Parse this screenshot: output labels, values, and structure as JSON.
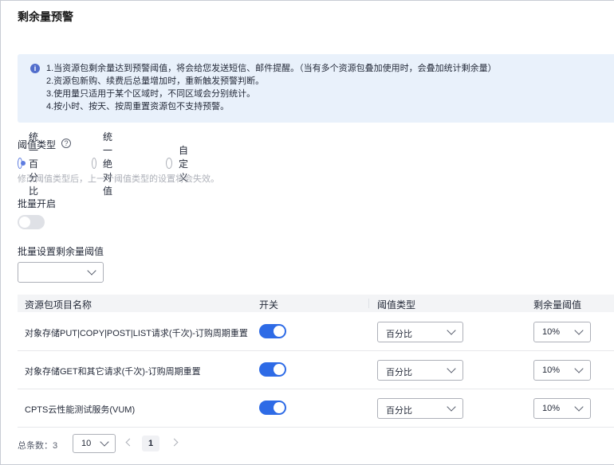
{
  "page": {
    "title": "剩余量预警"
  },
  "notice": {
    "icon": "info-icon",
    "lines": [
      "1.当资源包剩余量达到预警阈值，将会给您发送短信、邮件提醒。（当有多个资源包叠加使用时，会叠加统计剩余量）",
      "2.资源包新购、续费后总量增加时，重新触发预警判断。",
      "3.使用量只适用于某个区域时，不同区域会分别统计。",
      "4.按小时、按天、按周重置资源包不支持预警。"
    ]
  },
  "threshold_type": {
    "label": "阈值类型",
    "help_icon": "question-circle-icon",
    "options": [
      {
        "label": "统一百分比",
        "checked": true
      },
      {
        "label": "统一绝对值",
        "checked": false
      },
      {
        "label": "自定义",
        "checked": false
      }
    ],
    "hint": "修改阈值类型后，上一个阈值类型的设置将会失效。"
  },
  "batch": {
    "enable_label": "批量开启",
    "enabled": false,
    "threshold_label": "批量设置剩余量阈值",
    "threshold_value": ""
  },
  "table": {
    "columns": [
      "资源包项目名称",
      "开关",
      "阈值类型",
      "剩余量阈值"
    ],
    "rows": [
      {
        "name": "对象存储PUT|COPY|POST|LIST请求(千次)-订购周期重置",
        "enabled": true,
        "type": "百分比",
        "threshold": "10%"
      },
      {
        "name": "对象存储GET和其它请求(千次)-订购周期重置",
        "enabled": true,
        "type": "百分比",
        "threshold": "10%"
      },
      {
        "name": "CPTS云性能测试服务(VUM)",
        "enabled": true,
        "type": "百分比",
        "threshold": "10%"
      }
    ]
  },
  "pagination": {
    "total_label": "总条数：",
    "total": "3",
    "page_size": "10",
    "current_page": "1"
  }
}
